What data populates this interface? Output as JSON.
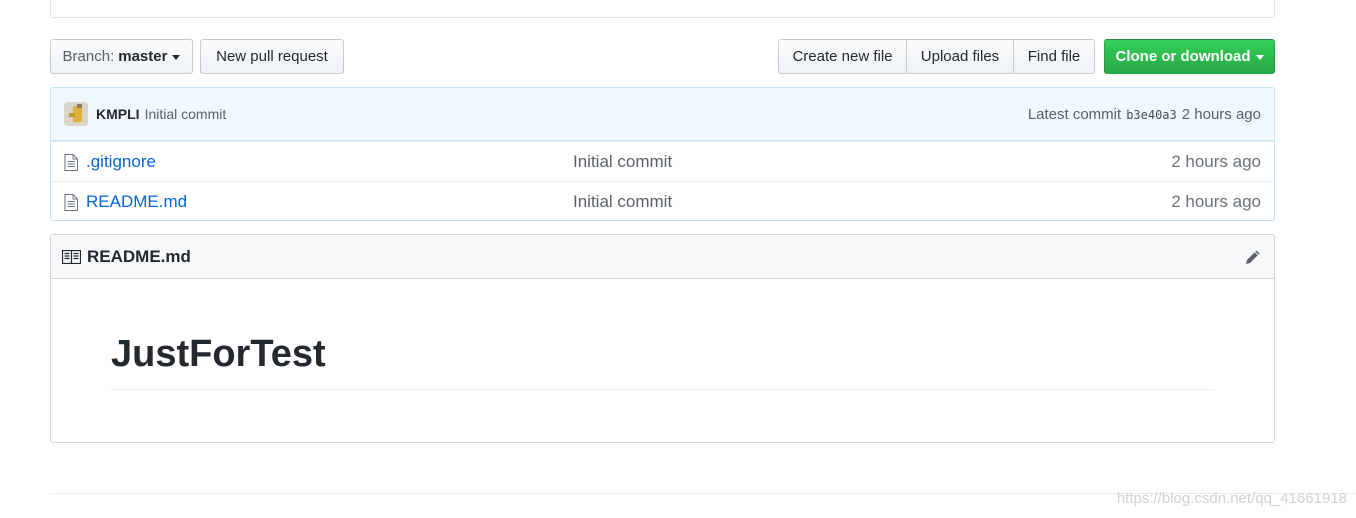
{
  "toolbar": {
    "branch_prefix": "Branch:",
    "branch_value": "master",
    "new_pr_label": "New pull request",
    "create_file_label": "Create new file",
    "upload_files_label": "Upload files",
    "find_file_label": "Find file",
    "clone_label": "Clone or download"
  },
  "commit": {
    "author": "KMPLI",
    "message": "Initial commit",
    "latest_label": "Latest commit",
    "sha": "b3e40a3",
    "age": "2 hours ago"
  },
  "files": [
    {
      "name": ".gitignore",
      "message": "Initial commit",
      "age": "2 hours ago",
      "icon": "file-icon"
    },
    {
      "name": "README.md",
      "message": "Initial commit",
      "age": "2 hours ago",
      "icon": "file-icon"
    }
  ],
  "readme": {
    "title": "README.md",
    "heading": "JustForTest"
  },
  "watermark": "https://blog.csdn.net/qq_41661918",
  "colors": {
    "clone_button": "#28a745",
    "link": "#0366d6",
    "commit_bg": "#f1f8ff"
  }
}
